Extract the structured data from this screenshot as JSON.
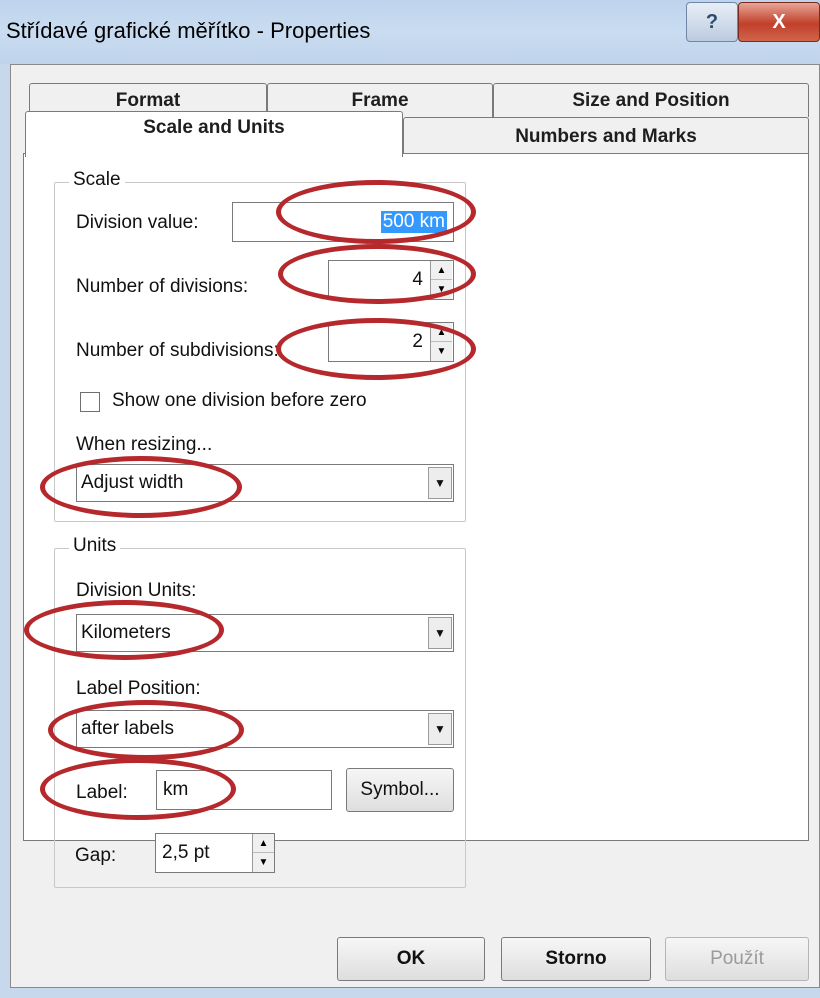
{
  "window": {
    "title": "Střídavé grafické měřítko - Properties",
    "help_glyph": "?",
    "close_glyph": "X"
  },
  "tabs": {
    "format": "Format",
    "frame": "Frame",
    "size_position": "Size and Position",
    "scale_units": "Scale and Units",
    "numbers_marks": "Numbers and Marks"
  },
  "scale": {
    "group_title": "Scale",
    "division_value_label": "Division value:",
    "division_value": "500 km",
    "num_divisions_label": "Number of divisions:",
    "num_divisions": "4",
    "num_subdivisions_label": "Number of subdivisions:",
    "num_subdivisions": "2",
    "show_division_label": "Show one division before zero",
    "show_division_checked": false,
    "when_resizing_label": "When resizing...",
    "when_resizing_value": "Adjust width"
  },
  "units": {
    "group_title": "Units",
    "division_units_label": "Division Units:",
    "division_units_value": "Kilometers",
    "label_position_label": "Label Position:",
    "label_position_value": "after labels",
    "label_label": "Label:",
    "label_value": "km",
    "symbol_button": "Symbol...",
    "gap_label": "Gap:",
    "gap_value": "2,5 pt"
  },
  "footer": {
    "ok": "OK",
    "cancel": "Storno",
    "apply": "Použít"
  },
  "glyphs": {
    "spin_up": "▲",
    "spin_down": "▼",
    "dropdown": "▼"
  },
  "colors": {
    "annotation": "#b5282c",
    "selection": "#3399ff"
  }
}
